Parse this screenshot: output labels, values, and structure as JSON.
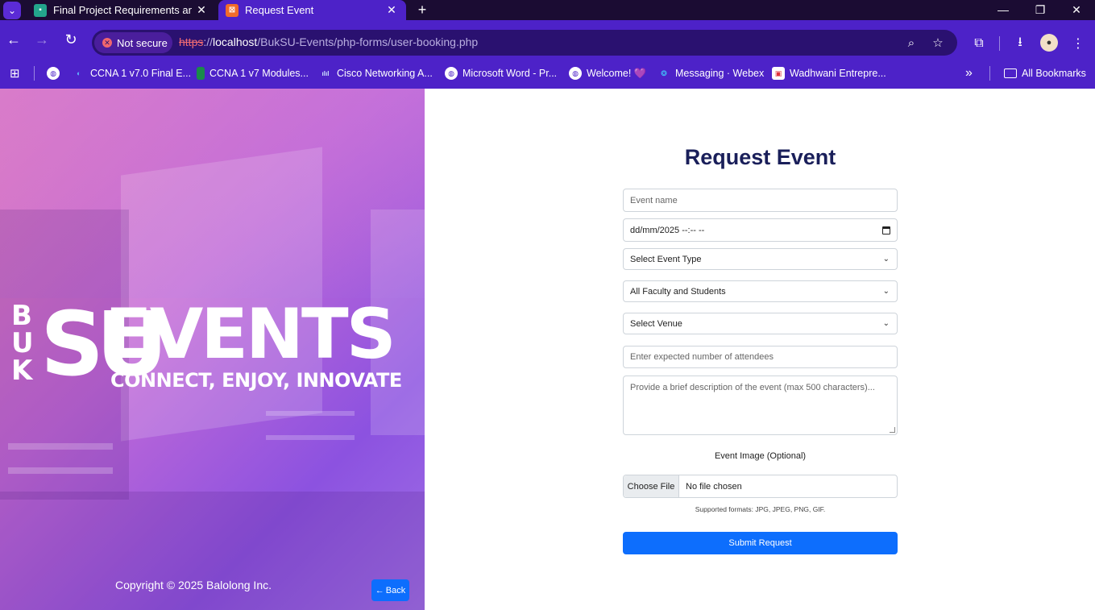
{
  "browser": {
    "tabs": [
      {
        "title": "Final Project Requirements and",
        "icon": "classroom-icon",
        "active": false
      },
      {
        "title": "Request Event",
        "icon": "xampp-icon",
        "active": true
      }
    ],
    "new_tab_glyph": "+",
    "security_label": "Not secure",
    "url": {
      "scheme": "https",
      "sep": "://",
      "host": "localhost",
      "path": "/BukSU-Events/php-forms/user-booking.php"
    },
    "bookmarks": [
      {
        "label": "CCNA 1 v7.0 Final E...",
        "icon": "ccna-icon"
      },
      {
        "label": "CCNA 1 v7 Modules...",
        "icon": "bookmark-flag-icon"
      },
      {
        "label": "Cisco Networking A...",
        "icon": "cisco-icon"
      },
      {
        "label": "Microsoft Word - Pr...",
        "icon": "globe-icon"
      },
      {
        "label": "Welcome! 💜",
        "icon": "globe-icon"
      },
      {
        "label": "Messaging · Webex",
        "icon": "webex-icon"
      },
      {
        "label": "Wadhwani Entrepre...",
        "icon": "wadhwani-icon"
      }
    ],
    "all_bookmarks": "All Bookmarks",
    "overflow_glyph": "»"
  },
  "hero": {
    "logo_letters": [
      "B",
      "U",
      "K",
      "SU"
    ],
    "logo_word": "EVENTS",
    "tagline": "CONNECT, ENJOY, INNOVATE",
    "copyright": "Copyright © 2025 Balolong Inc.",
    "back_label": "Back"
  },
  "form": {
    "title": "Request Event",
    "event_name_placeholder": "Event name",
    "datetime_value": "dd/mm/2025 --:-- --",
    "event_type_selected": "Select Event Type",
    "audience_selected": "All Faculty and Students",
    "venue_selected": "Select Venue",
    "attendees_placeholder": "Enter expected number of attendees",
    "description_placeholder": "Provide a brief description of the event (max 500 characters)...",
    "image_label": "Event Image (Optional)",
    "choose_file_label": "Choose File",
    "file_status": "No file chosen",
    "formats_note": "Supported formats: JPG, JPEG, PNG, GIF.",
    "submit_label": "Submit Request"
  },
  "colors": {
    "browser_frame": "#4d22c8",
    "tab_strip": "#1b0c33",
    "omnibox": "#2a1170",
    "primary_button": "#0d6efd",
    "title_text": "#1a1f5a"
  }
}
